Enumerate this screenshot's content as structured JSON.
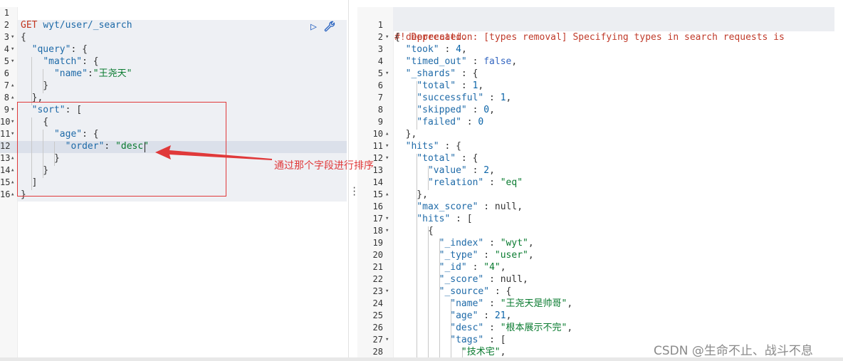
{
  "request": {
    "method": "GET",
    "path": "wyt/user/_search",
    "lines": [
      {
        "n": "1",
        "fold": "",
        "tokens": []
      },
      {
        "n": "2",
        "fold": "",
        "tokens": [
          [
            "method",
            "GET"
          ],
          [
            "pun",
            " "
          ],
          [
            "url",
            "wyt/user/_search"
          ]
        ]
      },
      {
        "n": "3",
        "fold": "▾",
        "tokens": [
          [
            "pun",
            "{"
          ]
        ]
      },
      {
        "n": "4",
        "fold": "▾",
        "tokens": [
          [
            "pun",
            "  "
          ],
          [
            "key",
            "\"query\""
          ],
          [
            "pun",
            ": {"
          ]
        ]
      },
      {
        "n": "5",
        "fold": "▾",
        "tokens": [
          [
            "pun",
            "    "
          ],
          [
            "key",
            "\"match\""
          ],
          [
            "pun",
            ": {"
          ]
        ]
      },
      {
        "n": "6",
        "fold": "",
        "tokens": [
          [
            "pun",
            "      "
          ],
          [
            "key",
            "\"name\""
          ],
          [
            "pun",
            ":"
          ],
          [
            "str",
            "\"王尧天\""
          ]
        ]
      },
      {
        "n": "7",
        "fold": "▴",
        "tokens": [
          [
            "pun",
            "    }"
          ]
        ]
      },
      {
        "n": "8",
        "fold": "▴",
        "tokens": [
          [
            "pun",
            "  },"
          ]
        ]
      },
      {
        "n": "9",
        "fold": "▾",
        "tokens": [
          [
            "pun",
            "  "
          ],
          [
            "key",
            "\"sort\""
          ],
          [
            "pun",
            ": ["
          ]
        ]
      },
      {
        "n": "10",
        "fold": "▾",
        "tokens": [
          [
            "pun",
            "    {"
          ]
        ]
      },
      {
        "n": "11",
        "fold": "▾",
        "tokens": [
          [
            "pun",
            "      "
          ],
          [
            "key",
            "\"age\""
          ],
          [
            "pun",
            ": {"
          ]
        ]
      },
      {
        "n": "12",
        "fold": "",
        "tokens": [
          [
            "pun",
            "        "
          ],
          [
            "key",
            "\"order\""
          ],
          [
            "pun",
            ": "
          ],
          [
            "str",
            "\"desc\""
          ]
        ]
      },
      {
        "n": "13",
        "fold": "▴",
        "tokens": [
          [
            "pun",
            "      }"
          ]
        ]
      },
      {
        "n": "14",
        "fold": "▴",
        "tokens": [
          [
            "pun",
            "    }"
          ]
        ]
      },
      {
        "n": "15",
        "fold": "▴",
        "tokens": [
          [
            "pun",
            "  ]"
          ]
        ]
      },
      {
        "n": "16",
        "fold": "▴",
        "tokens": [
          [
            "pun",
            "}"
          ]
        ]
      }
    ]
  },
  "response": {
    "warning_line1": "#! Deprecation: [types removal] Specifying types in search requests is",
    "warning_line2": "deprecated.",
    "lines": [
      {
        "n": "2",
        "fold": "▾",
        "tokens": [
          [
            "pun",
            "{"
          ]
        ]
      },
      {
        "n": "3",
        "fold": "",
        "tokens": [
          [
            "pun",
            "  "
          ],
          [
            "key",
            "\"took\""
          ],
          [
            "pun",
            " : "
          ],
          [
            "num",
            "4"
          ],
          [
            "pun",
            ","
          ]
        ]
      },
      {
        "n": "4",
        "fold": "",
        "tokens": [
          [
            "pun",
            "  "
          ],
          [
            "key",
            "\"timed_out\""
          ],
          [
            "pun",
            " : "
          ],
          [
            "kw",
            "false"
          ],
          [
            "pun",
            ","
          ]
        ]
      },
      {
        "n": "5",
        "fold": "▾",
        "tokens": [
          [
            "pun",
            "  "
          ],
          [
            "key",
            "\"_shards\""
          ],
          [
            "pun",
            " : {"
          ]
        ]
      },
      {
        "n": "6",
        "fold": "",
        "tokens": [
          [
            "pun",
            "    "
          ],
          [
            "key",
            "\"total\""
          ],
          [
            "pun",
            " : "
          ],
          [
            "num",
            "1"
          ],
          [
            "pun",
            ","
          ]
        ]
      },
      {
        "n": "7",
        "fold": "",
        "tokens": [
          [
            "pun",
            "    "
          ],
          [
            "key",
            "\"successful\""
          ],
          [
            "pun",
            " : "
          ],
          [
            "num",
            "1"
          ],
          [
            "pun",
            ","
          ]
        ]
      },
      {
        "n": "8",
        "fold": "",
        "tokens": [
          [
            "pun",
            "    "
          ],
          [
            "key",
            "\"skipped\""
          ],
          [
            "pun",
            " : "
          ],
          [
            "num",
            "0"
          ],
          [
            "pun",
            ","
          ]
        ]
      },
      {
        "n": "9",
        "fold": "",
        "tokens": [
          [
            "pun",
            "    "
          ],
          [
            "key",
            "\"failed\""
          ],
          [
            "pun",
            " : "
          ],
          [
            "num",
            "0"
          ]
        ]
      },
      {
        "n": "10",
        "fold": "▴",
        "tokens": [
          [
            "pun",
            "  },"
          ]
        ]
      },
      {
        "n": "11",
        "fold": "▾",
        "tokens": [
          [
            "pun",
            "  "
          ],
          [
            "key",
            "\"hits\""
          ],
          [
            "pun",
            " : {"
          ]
        ]
      },
      {
        "n": "12",
        "fold": "▾",
        "tokens": [
          [
            "pun",
            "    "
          ],
          [
            "key",
            "\"total\""
          ],
          [
            "pun",
            " : {"
          ]
        ]
      },
      {
        "n": "13",
        "fold": "",
        "tokens": [
          [
            "pun",
            "      "
          ],
          [
            "key",
            "\"value\""
          ],
          [
            "pun",
            " : "
          ],
          [
            "num",
            "2"
          ],
          [
            "pun",
            ","
          ]
        ]
      },
      {
        "n": "14",
        "fold": "",
        "tokens": [
          [
            "pun",
            "      "
          ],
          [
            "key",
            "\"relation\""
          ],
          [
            "pun",
            " : "
          ],
          [
            "str",
            "\"eq\""
          ]
        ]
      },
      {
        "n": "15",
        "fold": "▴",
        "tokens": [
          [
            "pun",
            "    },"
          ]
        ]
      },
      {
        "n": "16",
        "fold": "",
        "tokens": [
          [
            "pun",
            "    "
          ],
          [
            "key",
            "\"max_score\""
          ],
          [
            "pun",
            " : null,"
          ]
        ]
      },
      {
        "n": "17",
        "fold": "▾",
        "tokens": [
          [
            "pun",
            "    "
          ],
          [
            "key",
            "\"hits\""
          ],
          [
            "pun",
            " : ["
          ]
        ]
      },
      {
        "n": "18",
        "fold": "▾",
        "tokens": [
          [
            "pun",
            "      {"
          ]
        ]
      },
      {
        "n": "19",
        "fold": "",
        "tokens": [
          [
            "pun",
            "        "
          ],
          [
            "key",
            "\"_index\""
          ],
          [
            "pun",
            " : "
          ],
          [
            "str",
            "\"wyt\""
          ],
          [
            "pun",
            ","
          ]
        ]
      },
      {
        "n": "20",
        "fold": "",
        "tokens": [
          [
            "pun",
            "        "
          ],
          [
            "key",
            "\"_type\""
          ],
          [
            "pun",
            " : "
          ],
          [
            "str",
            "\"user\""
          ],
          [
            "pun",
            ","
          ]
        ]
      },
      {
        "n": "21",
        "fold": "",
        "tokens": [
          [
            "pun",
            "        "
          ],
          [
            "key",
            "\"_id\""
          ],
          [
            "pun",
            " : "
          ],
          [
            "str",
            "\"4\""
          ],
          [
            "pun",
            ","
          ]
        ]
      },
      {
        "n": "22",
        "fold": "",
        "tokens": [
          [
            "pun",
            "        "
          ],
          [
            "key",
            "\"_score\""
          ],
          [
            "pun",
            " : null,"
          ]
        ]
      },
      {
        "n": "23",
        "fold": "▾",
        "tokens": [
          [
            "pun",
            "        "
          ],
          [
            "key",
            "\"_source\""
          ],
          [
            "pun",
            " : {"
          ]
        ]
      },
      {
        "n": "24",
        "fold": "",
        "tokens": [
          [
            "pun",
            "          "
          ],
          [
            "key",
            "\"name\""
          ],
          [
            "pun",
            " : "
          ],
          [
            "str",
            "\"王尧天是帅哥\""
          ],
          [
            "pun",
            ","
          ]
        ]
      },
      {
        "n": "25",
        "fold": "",
        "tokens": [
          [
            "pun",
            "          "
          ],
          [
            "key",
            "\"age\""
          ],
          [
            "pun",
            " : "
          ],
          [
            "num",
            "21"
          ],
          [
            "pun",
            ","
          ]
        ]
      },
      {
        "n": "26",
        "fold": "",
        "tokens": [
          [
            "pun",
            "          "
          ],
          [
            "key",
            "\"desc\""
          ],
          [
            "pun",
            " : "
          ],
          [
            "str",
            "\"根本展示不完\""
          ],
          [
            "pun",
            ","
          ]
        ]
      },
      {
        "n": "27",
        "fold": "▾",
        "tokens": [
          [
            "pun",
            "          "
          ],
          [
            "key",
            "\"tags\""
          ],
          [
            "pun",
            " : ["
          ]
        ]
      },
      {
        "n": "28",
        "fold": "",
        "tokens": [
          [
            "pun",
            "            "
          ],
          [
            "str",
            "\"技术宅\""
          ],
          [
            "pun",
            ","
          ]
        ]
      }
    ]
  },
  "annotation": "通过那个字段进行排序",
  "watermark": "CSDN @生命不止、战斗不息",
  "icons": {
    "run": "play-icon",
    "settings": "wrench-icon"
  },
  "colors": {
    "annotation": "#e0393a",
    "key": "#1e6aa8",
    "string": "#0a7b30",
    "method": "#c2361e"
  }
}
